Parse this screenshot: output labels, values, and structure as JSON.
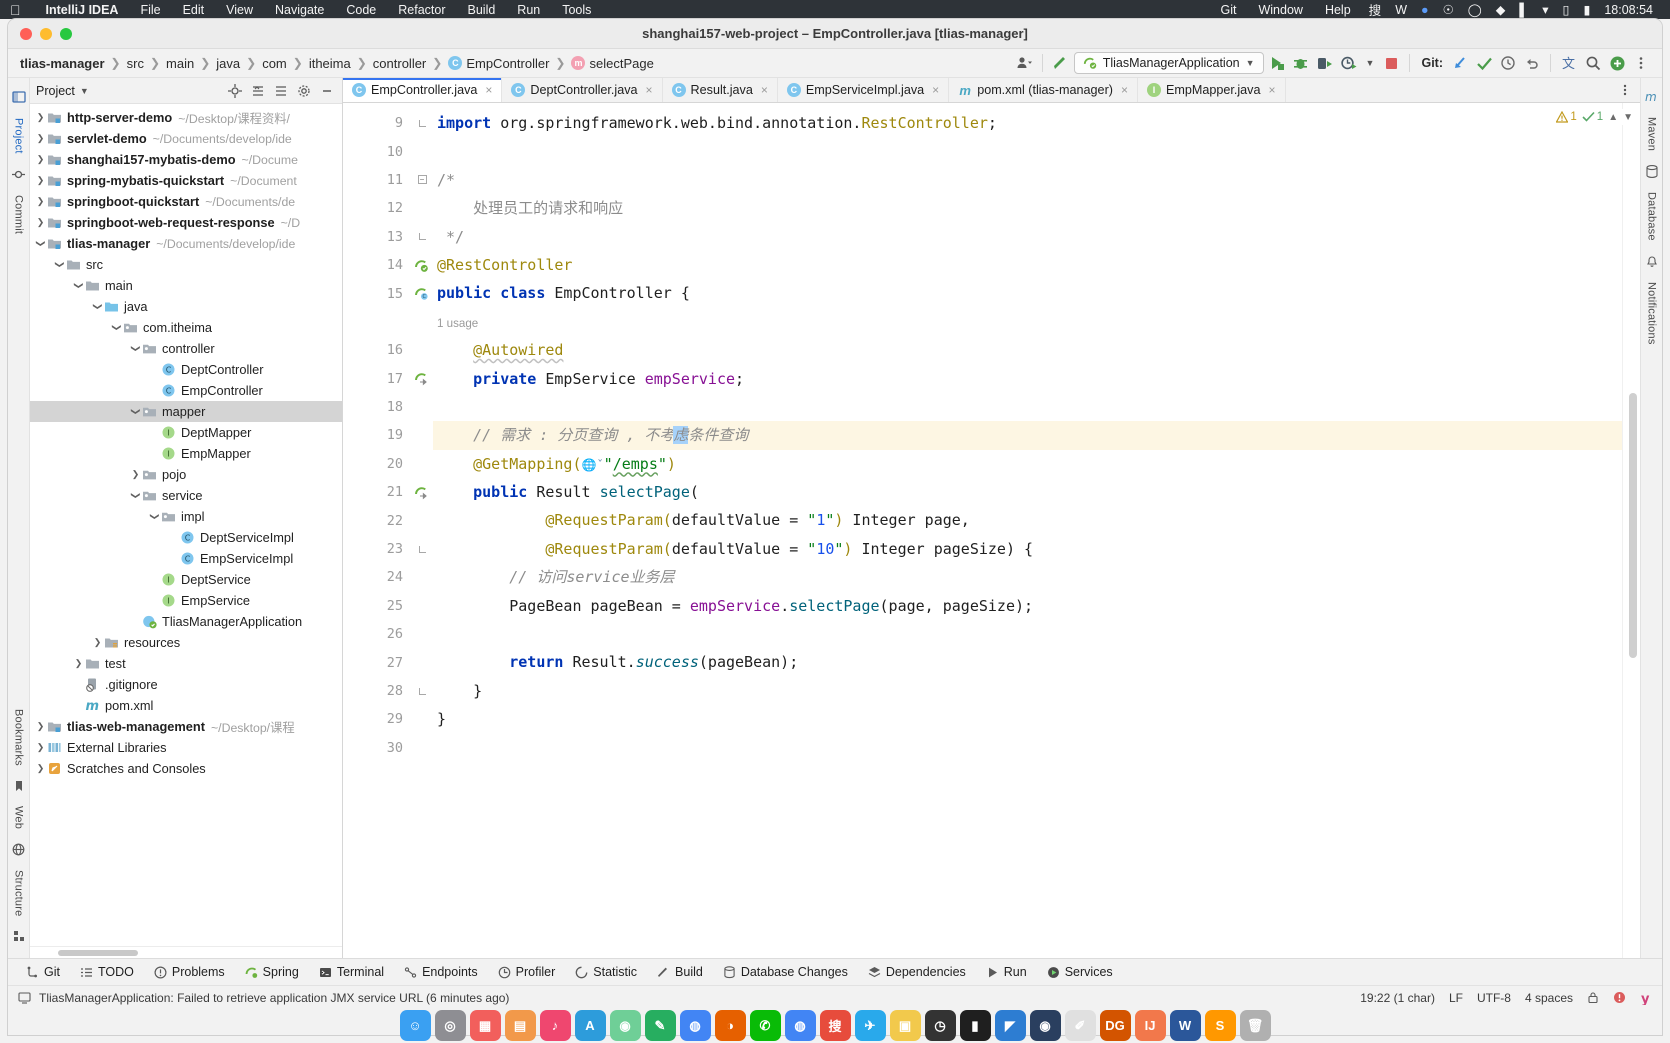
{
  "macmenu": {
    "app": "IntelliJ IDEA",
    "items": [
      "File",
      "Edit",
      "View",
      "Navigate",
      "Code",
      "Refactor",
      "Build",
      "Run",
      "Tools"
    ],
    "right_items": [
      "Git",
      "Window",
      "Help"
    ],
    "clock": "18:08:54"
  },
  "window": {
    "title": "shanghai157-web-project – EmpController.java [tlias-manager]"
  },
  "breadcrumb": [
    {
      "label": "tlias-manager",
      "icon": null
    },
    {
      "label": "src",
      "icon": null
    },
    {
      "label": "main",
      "icon": null
    },
    {
      "label": "java",
      "icon": null
    },
    {
      "label": "com",
      "icon": null
    },
    {
      "label": "itheima",
      "icon": null
    },
    {
      "label": "controller",
      "icon": null
    },
    {
      "label": "EmpController",
      "icon": "class-icon"
    },
    {
      "label": "selectPage",
      "icon": "method-icon"
    }
  ],
  "toolbar": {
    "run_config": "TliasManagerApplication",
    "git_label": "Git:",
    "icons": [
      "profile-icon",
      "back-arrow-icon",
      "run-icon",
      "debug-icon",
      "run-coverage-icon",
      "profiler-icon",
      "stop-icon",
      "update-project-icon",
      "commit-icon",
      "history-icon",
      "rollback-icon",
      "translate-icon",
      "search-icon",
      "account-icon",
      "more-icon"
    ]
  },
  "project_panel": {
    "title": "Project",
    "header_icons": [
      "locate-icon",
      "expand-icon",
      "collapse-icon",
      "settings-icon",
      "hide-icon"
    ],
    "tree": [
      {
        "depth": 0,
        "arrow": "right",
        "icon": "module-folder",
        "label": "http-server-demo",
        "bold": true,
        "path": "~/Desktop/课程资料/",
        "selected": false
      },
      {
        "depth": 0,
        "arrow": "right",
        "icon": "module-folder",
        "label": "servlet-demo",
        "bold": true,
        "path": "~/Documents/develop/ide",
        "selected": false
      },
      {
        "depth": 0,
        "arrow": "right",
        "icon": "module-folder",
        "label": "shanghai157-mybatis-demo",
        "bold": true,
        "path": "~/Docume",
        "selected": false
      },
      {
        "depth": 0,
        "arrow": "right",
        "icon": "module-folder",
        "label": "spring-mybatis-quickstart",
        "bold": true,
        "path": "~/Document",
        "selected": false
      },
      {
        "depth": 0,
        "arrow": "right",
        "icon": "module-folder",
        "label": "springboot-quickstart",
        "bold": true,
        "path": "~/Documents/de",
        "selected": false
      },
      {
        "depth": 0,
        "arrow": "right",
        "icon": "module-folder",
        "label": "springboot-web-request-response",
        "bold": true,
        "path": "~/D",
        "selected": false
      },
      {
        "depth": 0,
        "arrow": "down",
        "icon": "module-folder",
        "label": "tlias-manager",
        "bold": true,
        "path": "~/Documents/develop/ide",
        "selected": false
      },
      {
        "depth": 1,
        "arrow": "down",
        "icon": "folder",
        "label": "src",
        "bold": false,
        "path": "",
        "selected": false
      },
      {
        "depth": 2,
        "arrow": "down",
        "icon": "folder",
        "label": "main",
        "bold": false,
        "path": "",
        "selected": false
      },
      {
        "depth": 3,
        "arrow": "down",
        "icon": "source-folder",
        "label": "java",
        "bold": false,
        "path": "",
        "selected": false
      },
      {
        "depth": 4,
        "arrow": "down",
        "icon": "package",
        "label": "com.itheima",
        "bold": false,
        "path": "",
        "selected": false
      },
      {
        "depth": 5,
        "arrow": "down",
        "icon": "package",
        "label": "controller",
        "bold": false,
        "path": "",
        "selected": false
      },
      {
        "depth": 6,
        "arrow": "none",
        "icon": "class-icon",
        "label": "DeptController",
        "bold": false,
        "path": "",
        "selected": false
      },
      {
        "depth": 6,
        "arrow": "none",
        "icon": "class-icon",
        "label": "EmpController",
        "bold": false,
        "path": "",
        "selected": false
      },
      {
        "depth": 5,
        "arrow": "down",
        "icon": "package",
        "label": "mapper",
        "bold": false,
        "path": "",
        "selected": true
      },
      {
        "depth": 6,
        "arrow": "none",
        "icon": "interface-icon",
        "label": "DeptMapper",
        "bold": false,
        "path": "",
        "selected": false
      },
      {
        "depth": 6,
        "arrow": "none",
        "icon": "interface-icon",
        "label": "EmpMapper",
        "bold": false,
        "path": "",
        "selected": false
      },
      {
        "depth": 5,
        "arrow": "right",
        "icon": "package",
        "label": "pojo",
        "bold": false,
        "path": "",
        "selected": false
      },
      {
        "depth": 5,
        "arrow": "down",
        "icon": "package",
        "label": "service",
        "bold": false,
        "path": "",
        "selected": false
      },
      {
        "depth": 6,
        "arrow": "down",
        "icon": "package",
        "label": "impl",
        "bold": false,
        "path": "",
        "selected": false
      },
      {
        "depth": 7,
        "arrow": "none",
        "icon": "class-icon",
        "label": "DeptServiceImpl",
        "bold": false,
        "path": "",
        "selected": false
      },
      {
        "depth": 7,
        "arrow": "none",
        "icon": "class-icon",
        "label": "EmpServiceImpl",
        "bold": false,
        "path": "",
        "selected": false
      },
      {
        "depth": 6,
        "arrow": "none",
        "icon": "interface-icon",
        "label": "DeptService",
        "bold": false,
        "path": "",
        "selected": false
      },
      {
        "depth": 6,
        "arrow": "none",
        "icon": "interface-icon",
        "label": "EmpService",
        "bold": false,
        "path": "",
        "selected": false
      },
      {
        "depth": 5,
        "arrow": "none",
        "icon": "spring-boot-class-icon",
        "label": "TliasManagerApplication",
        "bold": false,
        "path": "",
        "selected": false
      },
      {
        "depth": 3,
        "arrow": "right",
        "icon": "resources-folder",
        "label": "resources",
        "bold": false,
        "path": "",
        "selected": false
      },
      {
        "depth": 2,
        "arrow": "right",
        "icon": "folder",
        "label": "test",
        "bold": false,
        "path": "",
        "selected": false
      },
      {
        "depth": 2,
        "arrow": "none",
        "icon": "gitignore-icon",
        "label": ".gitignore",
        "bold": false,
        "path": "",
        "selected": false
      },
      {
        "depth": 2,
        "arrow": "none",
        "icon": "maven-icon",
        "label": "pom.xml",
        "bold": false,
        "path": "",
        "selected": false
      },
      {
        "depth": 0,
        "arrow": "right",
        "icon": "module-folder",
        "label": "tlias-web-management",
        "bold": true,
        "path": "~/Desktop/课程",
        "selected": false
      },
      {
        "depth": 0,
        "arrow": "right",
        "icon": "library-icon",
        "label": "External Libraries",
        "bold": false,
        "path": "",
        "selected": false
      },
      {
        "depth": 0,
        "arrow": "right",
        "icon": "scratch-icon",
        "label": "Scratches and Consoles",
        "bold": false,
        "path": "",
        "selected": false
      }
    ]
  },
  "editor_tabs": [
    {
      "label": "EmpController.java",
      "icon": "class-icon",
      "active": true
    },
    {
      "label": "DeptController.java",
      "icon": "class-icon",
      "active": false
    },
    {
      "label": "Result.java",
      "icon": "class-icon",
      "active": false
    },
    {
      "label": "EmpServiceImpl.java",
      "icon": "class-icon",
      "active": false
    },
    {
      "label": "pom.xml (tlias-manager)",
      "icon": "maven-icon",
      "active": false
    },
    {
      "label": "EmpMapper.java",
      "icon": "interface-icon",
      "active": false
    }
  ],
  "inspection": {
    "warnings": "1",
    "checks": "1"
  },
  "code": {
    "first_line": 9,
    "last_line": 30,
    "highlighted_line": 19,
    "selected_text": "考",
    "usage_hint": "1 usage",
    "lines": [
      {
        "n": 9,
        "text": "import org.springframework.web.bind.annotation.RestController;"
      },
      {
        "n": 10,
        "text": ""
      },
      {
        "n": 11,
        "text": "/*"
      },
      {
        "n": 12,
        "text": "    处理员工的请求和响应"
      },
      {
        "n": 13,
        "text": " */"
      },
      {
        "n": 14,
        "text": "@RestController"
      },
      {
        "n": 15,
        "text": "public class EmpController {"
      },
      {
        "n": null,
        "text": "    1 usage"
      },
      {
        "n": 16,
        "text": "    @Autowired"
      },
      {
        "n": 17,
        "text": "    private EmpService empService;"
      },
      {
        "n": 18,
        "text": ""
      },
      {
        "n": 19,
        "text": "    // 需求 : 分页查询 , 不考虑条件查询"
      },
      {
        "n": 20,
        "text": "    @GetMapping(\"/emps\")"
      },
      {
        "n": 21,
        "text": "    public Result selectPage("
      },
      {
        "n": 22,
        "text": "            @RequestParam(defaultValue = \"1\") Integer page,"
      },
      {
        "n": 23,
        "text": "            @RequestParam(defaultValue = \"10\") Integer pageSize) {"
      },
      {
        "n": 24,
        "text": "        // 访问service业务层"
      },
      {
        "n": 25,
        "text": "        PageBean pageBean = empService.selectPage(page, pageSize);"
      },
      {
        "n": 26,
        "text": ""
      },
      {
        "n": 27,
        "text": "        return Result.success(pageBean);"
      },
      {
        "n": 28,
        "text": "    }"
      },
      {
        "n": 29,
        "text": "}"
      },
      {
        "n": 30,
        "text": ""
      }
    ]
  },
  "left_rail": [
    "Project",
    "Commit",
    "Bookmarks",
    "Web",
    "Structure"
  ],
  "right_rail": [
    "Maven",
    "Database",
    "Notifications"
  ],
  "bottom_tools": [
    {
      "label": "Git",
      "icon": "git-icon"
    },
    {
      "label": "TODO",
      "icon": "todo-icon"
    },
    {
      "label": "Problems",
      "icon": "problems-icon"
    },
    {
      "label": "Spring",
      "icon": "spring-icon"
    },
    {
      "label": "Terminal",
      "icon": "terminal-icon"
    },
    {
      "label": "Endpoints",
      "icon": "endpoints-icon"
    },
    {
      "label": "Profiler",
      "icon": "profiler-icon"
    },
    {
      "label": "Statistic",
      "icon": "statistic-icon"
    },
    {
      "label": "Build",
      "icon": "build-icon"
    },
    {
      "label": "Database Changes",
      "icon": "database-changes-icon"
    },
    {
      "label": "Dependencies",
      "icon": "dependencies-icon"
    },
    {
      "label": "Run",
      "icon": "run-icon"
    },
    {
      "label": "Services",
      "icon": "services-icon"
    }
  ],
  "status_bar": {
    "message": "TliasManagerApplication: Failed to retrieve application JMX service URL (6 minutes ago)",
    "caret": "19:22 (1 char)",
    "line_sep": "LF",
    "encoding": "UTF-8",
    "indent": "4 spaces",
    "icons": [
      "lock-icon",
      "error-icon",
      "idea-icon"
    ]
  },
  "dock": {
    "items": [
      {
        "name": "finder-icon",
        "color": "#3aa0f2",
        "glyph": "☺"
      },
      {
        "name": "launchpad-icon",
        "color": "#8e8e93",
        "glyph": "◎"
      },
      {
        "name": "calendar-icon",
        "color": "#f25f5c",
        "glyph": "▦"
      },
      {
        "name": "browser-icon",
        "color": "#f2994a",
        "glyph": "▤"
      },
      {
        "name": "music-icon",
        "color": "#ef476f",
        "glyph": "♪"
      },
      {
        "name": "appstore-icon",
        "color": "#2d9cdb",
        "glyph": "A"
      },
      {
        "name": "preview-icon",
        "color": "#6fcf97",
        "glyph": "◉"
      },
      {
        "name": "notes-icon",
        "color": "#27ae60",
        "glyph": "✎"
      },
      {
        "name": "chrome-icon",
        "color": "#4285f4",
        "glyph": "◍"
      },
      {
        "name": "firefox-icon",
        "color": "#e66000",
        "glyph": "◑"
      },
      {
        "name": "wechat-icon",
        "color": "#09bb07",
        "glyph": "✆"
      },
      {
        "name": "chrome2-icon",
        "color": "#4285f4",
        "glyph": "◍"
      },
      {
        "name": "sogou-icon",
        "color": "#e74c3c",
        "glyph": "搜"
      },
      {
        "name": "telegram-icon",
        "color": "#29a9eb",
        "glyph": "✈"
      },
      {
        "name": "maps-icon",
        "color": "#f2c94c",
        "glyph": "▣"
      },
      {
        "name": "clock-icon",
        "color": "#333333",
        "glyph": "◷"
      },
      {
        "name": "terminal-icon",
        "color": "#1f1f1f",
        "glyph": "▮"
      },
      {
        "name": "vscode-icon",
        "color": "#2d7dd2",
        "glyph": "◤"
      },
      {
        "name": "steam-icon",
        "color": "#2a3f5f",
        "glyph": "◉"
      },
      {
        "name": "pencil-icon",
        "color": "#e0e0e0",
        "glyph": "✐"
      },
      {
        "name": "dg-icon",
        "color": "#d35400",
        "glyph": "DG"
      },
      {
        "name": "intellij-icon",
        "color": "#f2784b",
        "glyph": "IJ"
      },
      {
        "name": "word-icon",
        "color": "#2b579a",
        "glyph": "W"
      },
      {
        "name": "sublime-icon",
        "color": "#ff9800",
        "glyph": "S"
      },
      {
        "name": "trash-icon",
        "color": "#b0b0b0",
        "glyph": "🗑"
      }
    ]
  }
}
